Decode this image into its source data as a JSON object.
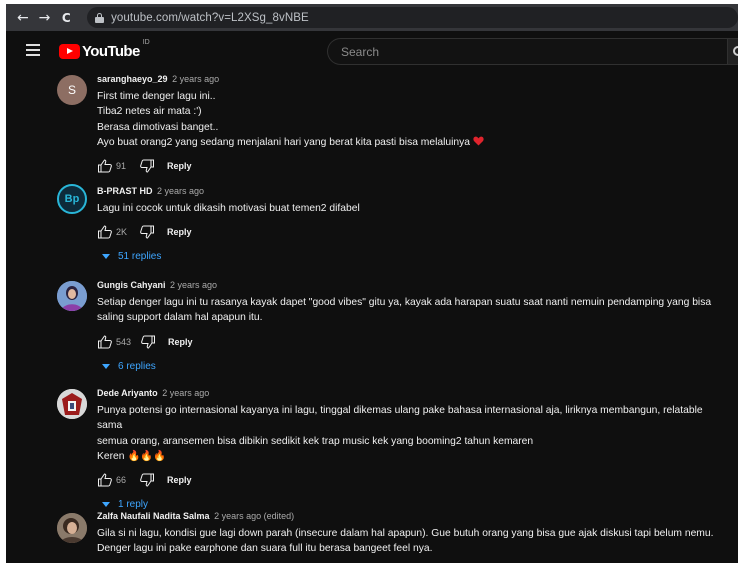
{
  "browser": {
    "back": "←",
    "forward": "→",
    "reload": "C",
    "url": "youtube.com/watch?v=L2XSg_8vNBE"
  },
  "masthead": {
    "logo": "YouTube",
    "country": "ID",
    "search_placeholder": "Search"
  },
  "colors": {
    "page_bg": "#0f0f0f",
    "text": "#f1f1f1",
    "secondary": "#aaaaaa",
    "link_blue": "#3ea6ff",
    "brand_red": "#ff0000"
  },
  "comments": [
    {
      "author": "saranghaeyo_29",
      "time": "2 years ago",
      "avatar_letter": "S",
      "lines": [
        "First time denger lagu ini..",
        "Tiba2 netes air mata :')",
        "Berasa dimotivasi banget..",
        "Ayo buat orang2 yang sedang menjalani hari  yang berat kita pasti bisa melaluinya"
      ],
      "emoji": "heart-icon",
      "likes": "91",
      "reply": "Reply"
    },
    {
      "author": "B-PRAST HD",
      "time": "2 years ago",
      "avatar_letter": "Bp",
      "lines": [
        "Lagu ini cocok untuk dikasih motivasi buat temen2 difabel"
      ],
      "likes": "2K",
      "reply": "Reply",
      "replies": "51 replies"
    },
    {
      "author": "Gungis Cahyani",
      "time": "2 years ago",
      "lines": [
        "Setiap denger lagu ini tu rasanya kayak dapet \"good vibes\" gitu ya, kayak ada harapan suatu saat nanti nemuin pendamping yang bisa",
        "saling support dalam hal apapun itu."
      ],
      "likes": "543",
      "reply": "Reply",
      "replies": "6 replies"
    },
    {
      "author": "Dede Ariyanto",
      "time": "2 years ago",
      "lines": [
        "Punya potensi go internasional kayanya ini lagu, tinggal dikemas ulang pake bahasa internasional aja, liriknya membangun, relatable sama",
        "semua orang, aransemen bisa dibikin sedikit kek trap music kek yang booming2 tahun kemaren",
        "Keren"
      ],
      "emoji": "🔥🔥🔥",
      "likes": "66",
      "reply": "Reply",
      "replies": "1 reply"
    },
    {
      "author": "Zalfa Naufali Nadita Salma",
      "time": "2 years ago (edited)",
      "lines": [
        "Gila si ni lagu, kondisi gue lagi down parah (insecure dalam hal apapun). Gue butuh orang yang bisa gue ajak diskusi tapi belum nemu.",
        "Denger lagu ini pake earphone dan suara full itu berasa bangeet feel nya."
      ]
    }
  ]
}
